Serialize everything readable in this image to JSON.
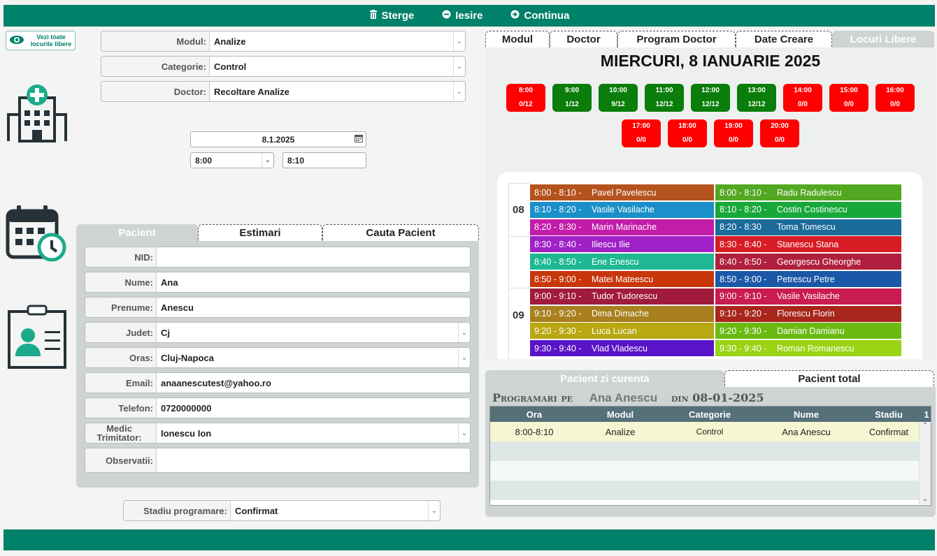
{
  "toolbar": {
    "sterge": "Sterge",
    "iesire": "Iesire",
    "continua": "Continua"
  },
  "vezi_label": "Vezi toate locurile libere",
  "filters": {
    "modul_label": "Modul:",
    "modul_value": "Analize",
    "categorie_label": "Categorie:",
    "categorie_value": "Control",
    "doctor_label": "Doctor:",
    "doctor_value": "Recoltare Analize"
  },
  "date_value": "8.1.2025",
  "time_from": "8:00",
  "time_to": "8:10",
  "patient_tabs": [
    "Pacient",
    "Estimari",
    "Cauta Pacient"
  ],
  "patient": {
    "nid_label": "NID:",
    "nid": "",
    "nume_label": "Nume:",
    "nume": "Ana",
    "prenume_label": "Prenume:",
    "prenume": "Anescu",
    "judet_label": "Judet:",
    "judet": "Cj",
    "oras_label": "Oras:",
    "oras": "Cluj-Napoca",
    "email_label": "Email:",
    "email": "anaanescutest@yahoo.ro",
    "telefon_label": "Telefon:",
    "telefon": "0720000000",
    "medic_label": "Medic Trimitator:",
    "medic": "Ionescu Ion",
    "obs_label": "Observatii:",
    "obs": ""
  },
  "stadiu_label": "Stadiu programare:",
  "stadiu_value": "Confirmat",
  "right_tabs": [
    "Modul",
    "Doctor",
    "Program Doctor",
    "Date Creare",
    "Locuri Libere"
  ],
  "day_title": "MIERCURI, 8 IANUARIE 2025",
  "slots_row1": [
    {
      "time": "8:00",
      "count": "0/12",
      "color": "#ff0000"
    },
    {
      "time": "9:00",
      "count": "1/12",
      "color": "#0a7d0a"
    },
    {
      "time": "10:00",
      "count": "9/12",
      "color": "#0a7d0a"
    },
    {
      "time": "11:00",
      "count": "12/12",
      "color": "#0a7d0a"
    },
    {
      "time": "12:00",
      "count": "12/12",
      "color": "#0a7d0a"
    },
    {
      "time": "13:00",
      "count": "12/12",
      "color": "#0a7d0a"
    },
    {
      "time": "14:00",
      "count": "0/0",
      "color": "#ff0000"
    },
    {
      "time": "15:00",
      "count": "0/0",
      "color": "#ff0000"
    },
    {
      "time": "16:00",
      "count": "0/0",
      "color": "#ff0000"
    }
  ],
  "slots_row2": [
    {
      "time": "17:00",
      "count": "0/0",
      "color": "#ff0000"
    },
    {
      "time": "18:00",
      "count": "0/0",
      "color": "#ff0000"
    },
    {
      "time": "19:00",
      "count": "0/0",
      "color": "#ff0000"
    },
    {
      "time": "20:00",
      "count": "0/0",
      "color": "#ff0000"
    }
  ],
  "hours": [
    "08",
    "09"
  ],
  "schedule_left": [
    {
      "t": "8:00 - 8:10 -",
      "n": "Pavel Pavelescu",
      "c": "#b5531e"
    },
    {
      "t": "8:10 - 8:20 -",
      "n": "Vasile Vasilache",
      "c": "#1a8fc9"
    },
    {
      "t": "8:20 - 8:30 -",
      "n": "Marin Marinache",
      "c": "#c21ca8"
    },
    {
      "t": "8:30 - 8:40 -",
      "n": "Iliescu Ilie",
      "c": "#a020c8"
    },
    {
      "t": "8:40 - 8:50 -",
      "n": "Ene Enescu",
      "c": "#1fb892"
    },
    {
      "t": "8:50 - 9:00 -",
      "n": "Matei Mateescu",
      "c": "#c8360c"
    },
    {
      "t": "9:00 - 9:10 -",
      "n": "Tudor Tudorescu",
      "c": "#a01b3c"
    },
    {
      "t": "9:10 - 9:20 -",
      "n": "Dima Dimache",
      "c": "#a8801e"
    },
    {
      "t": "9:20 - 9:30 -",
      "n": "Luca Lucan",
      "c": "#b8a812"
    },
    {
      "t": "9:30 - 9:40 -",
      "n": "Vlad Vladescu",
      "c": "#5a14c8"
    }
  ],
  "schedule_right": [
    {
      "t": "8:00 - 8:10 -",
      "n": "Radu Radulescu",
      "c": "#52a820"
    },
    {
      "t": "8:10 - 8:20 -",
      "n": "Costin Costinescu",
      "c": "#18a83a"
    },
    {
      "t": "8:20 - 8:30",
      "n": "Toma Tomescu",
      "c": "#1a6a9a"
    },
    {
      "t": "8:30 - 8:40 -",
      "n": "Stanescu Stana",
      "c": "#d81c24"
    },
    {
      "t": "8:40 - 8:50 -",
      "n": "Georgescu Gheorghe",
      "c": "#b0203e"
    },
    {
      "t": "8:50 - 9:00 -",
      "n": "Petrescu Petre",
      "c": "#1c58a8"
    },
    {
      "t": "9:00 - 9:10 -",
      "n": "Vasile Vasilache",
      "c": "#c81c52"
    },
    {
      "t": "9:10 - 9:20 -",
      "n": "Florescu Florin",
      "c": "#a8261c"
    },
    {
      "t": "9:20 - 9:30 -",
      "n": "Damian Damianu",
      "c": "#6aba12"
    },
    {
      "t": "9:30 - 9:40 -",
      "n": "Roman Romanescu",
      "c": "#9ad414"
    }
  ],
  "bottom_tabs": [
    "Pacient zi curenta",
    "Pacient total"
  ],
  "prog": {
    "prefix": "Programari pe",
    "name": "Ana Anescu",
    "din": "din",
    "date": "08-01-2025"
  },
  "table": {
    "headers": [
      "Ora",
      "Modul",
      "Categorie",
      "Nume",
      "Stadiu",
      "1"
    ],
    "rows": [
      [
        "8:00-8:10",
        "Analize",
        "Control",
        "Ana Anescu",
        "Confirmat"
      ]
    ]
  }
}
